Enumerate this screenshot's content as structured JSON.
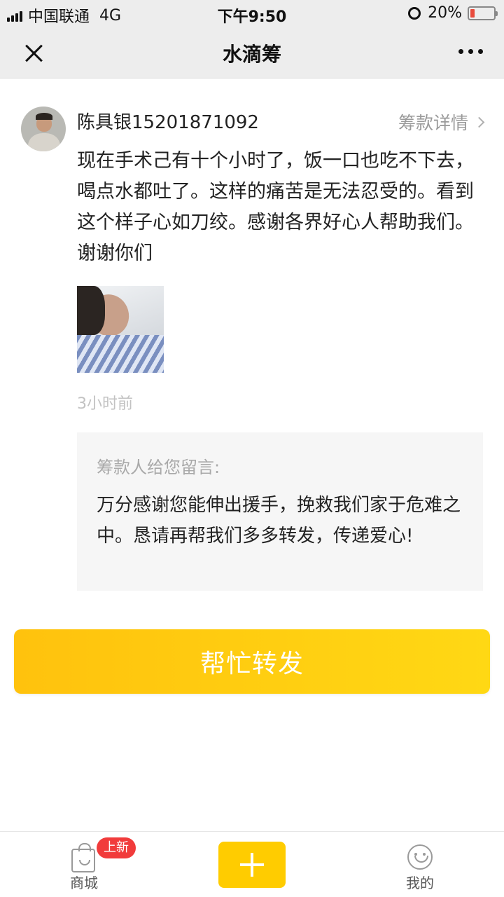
{
  "status_bar": {
    "carrier": "中国联通",
    "network": "4G",
    "time": "下午9:50",
    "battery": "20%",
    "battery_level": 0.2
  },
  "nav": {
    "title": "水滴筹"
  },
  "post": {
    "username": "陈具银15201871092",
    "detail_link": "筹款详情",
    "content": "现在手术己有十个小时了，饭一口也吃不下去，喝点水都吐了。这样的痛苦是无法忍受的。看到这个样子心如刀绞。感谢各界好心人帮助我们。谢谢你们",
    "time_ago": "3小时前"
  },
  "message": {
    "title": "筹款人给您留言:",
    "body": "万分感谢您能伸出援手，挽救我们家于危难之中。恳请再帮我们多多转发，传递爱心!"
  },
  "share_button": "帮忙转发",
  "tabbar": {
    "mall_label": "商城",
    "new_badge": "上新",
    "me_label": "我的"
  },
  "colors": {
    "accent": "#ffcc00",
    "badge": "#f13b3b"
  }
}
